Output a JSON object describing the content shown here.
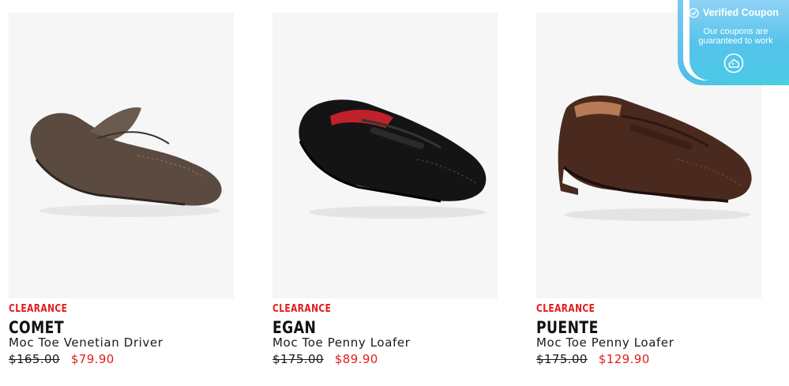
{
  "products": [
    {
      "tag": "CLEARANCE",
      "name": "COMET",
      "subtitle": "Moc Toe Venetian Driver",
      "price_original": "$165.00",
      "price_sale": "$79.90",
      "shoe_color": "#5a4a40"
    },
    {
      "tag": "CLEARANCE",
      "name": "EGAN",
      "subtitle": "Moc Toe Penny Loafer",
      "price_original": "$175.00",
      "price_sale": "$89.90",
      "shoe_color": "#141414"
    },
    {
      "tag": "CLEARANCE",
      "name": "PUENTE",
      "subtitle": "Moc Toe Penny Loafer",
      "price_original": "$175.00",
      "price_sale": "$129.90",
      "shoe_color": "#4a2a1f"
    }
  ],
  "coupon": {
    "title": "Verified Coupon",
    "message": "Our coupons are guaranteed to work",
    "accent": "#4fbde7"
  },
  "colors": {
    "sale": "#e21b1b",
    "image_bg": "#f6f6f6"
  }
}
